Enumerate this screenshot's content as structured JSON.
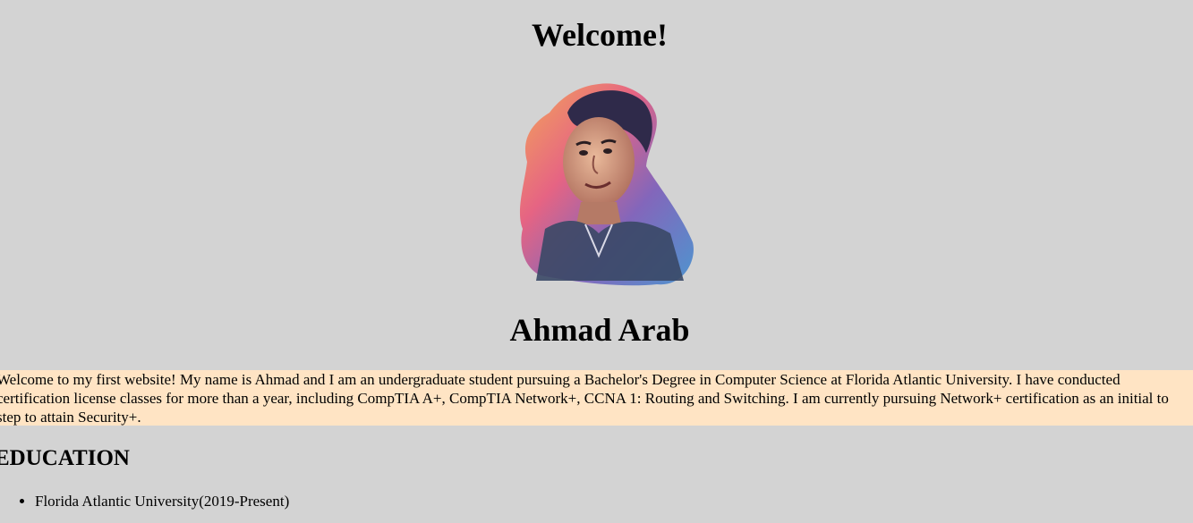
{
  "header": {
    "welcome_title": "Welcome!"
  },
  "profile": {
    "portrait_icon": "portrait-illustration",
    "name": "Ahmad Arab",
    "intro": "Welcome to my first website! My name is Ahmad and I am an undergraduate student pursuing a Bachelor's Degree in Computer Science at Florida Atlantic University. I have conducted certification license classes for more than a year, including CompTIA A+, CompTIA Network+, CCNA 1: Routing and Switching. I am currently pursuing Network+ certification as an initial to step to attain Security+."
  },
  "education": {
    "title": "EDUCATION",
    "items": [
      {
        "label": "Florida Atlantic University(2019-Present)"
      }
    ]
  },
  "colors": {
    "page_background": "#d3d3d3",
    "intro_background": "#ffe4c4"
  }
}
